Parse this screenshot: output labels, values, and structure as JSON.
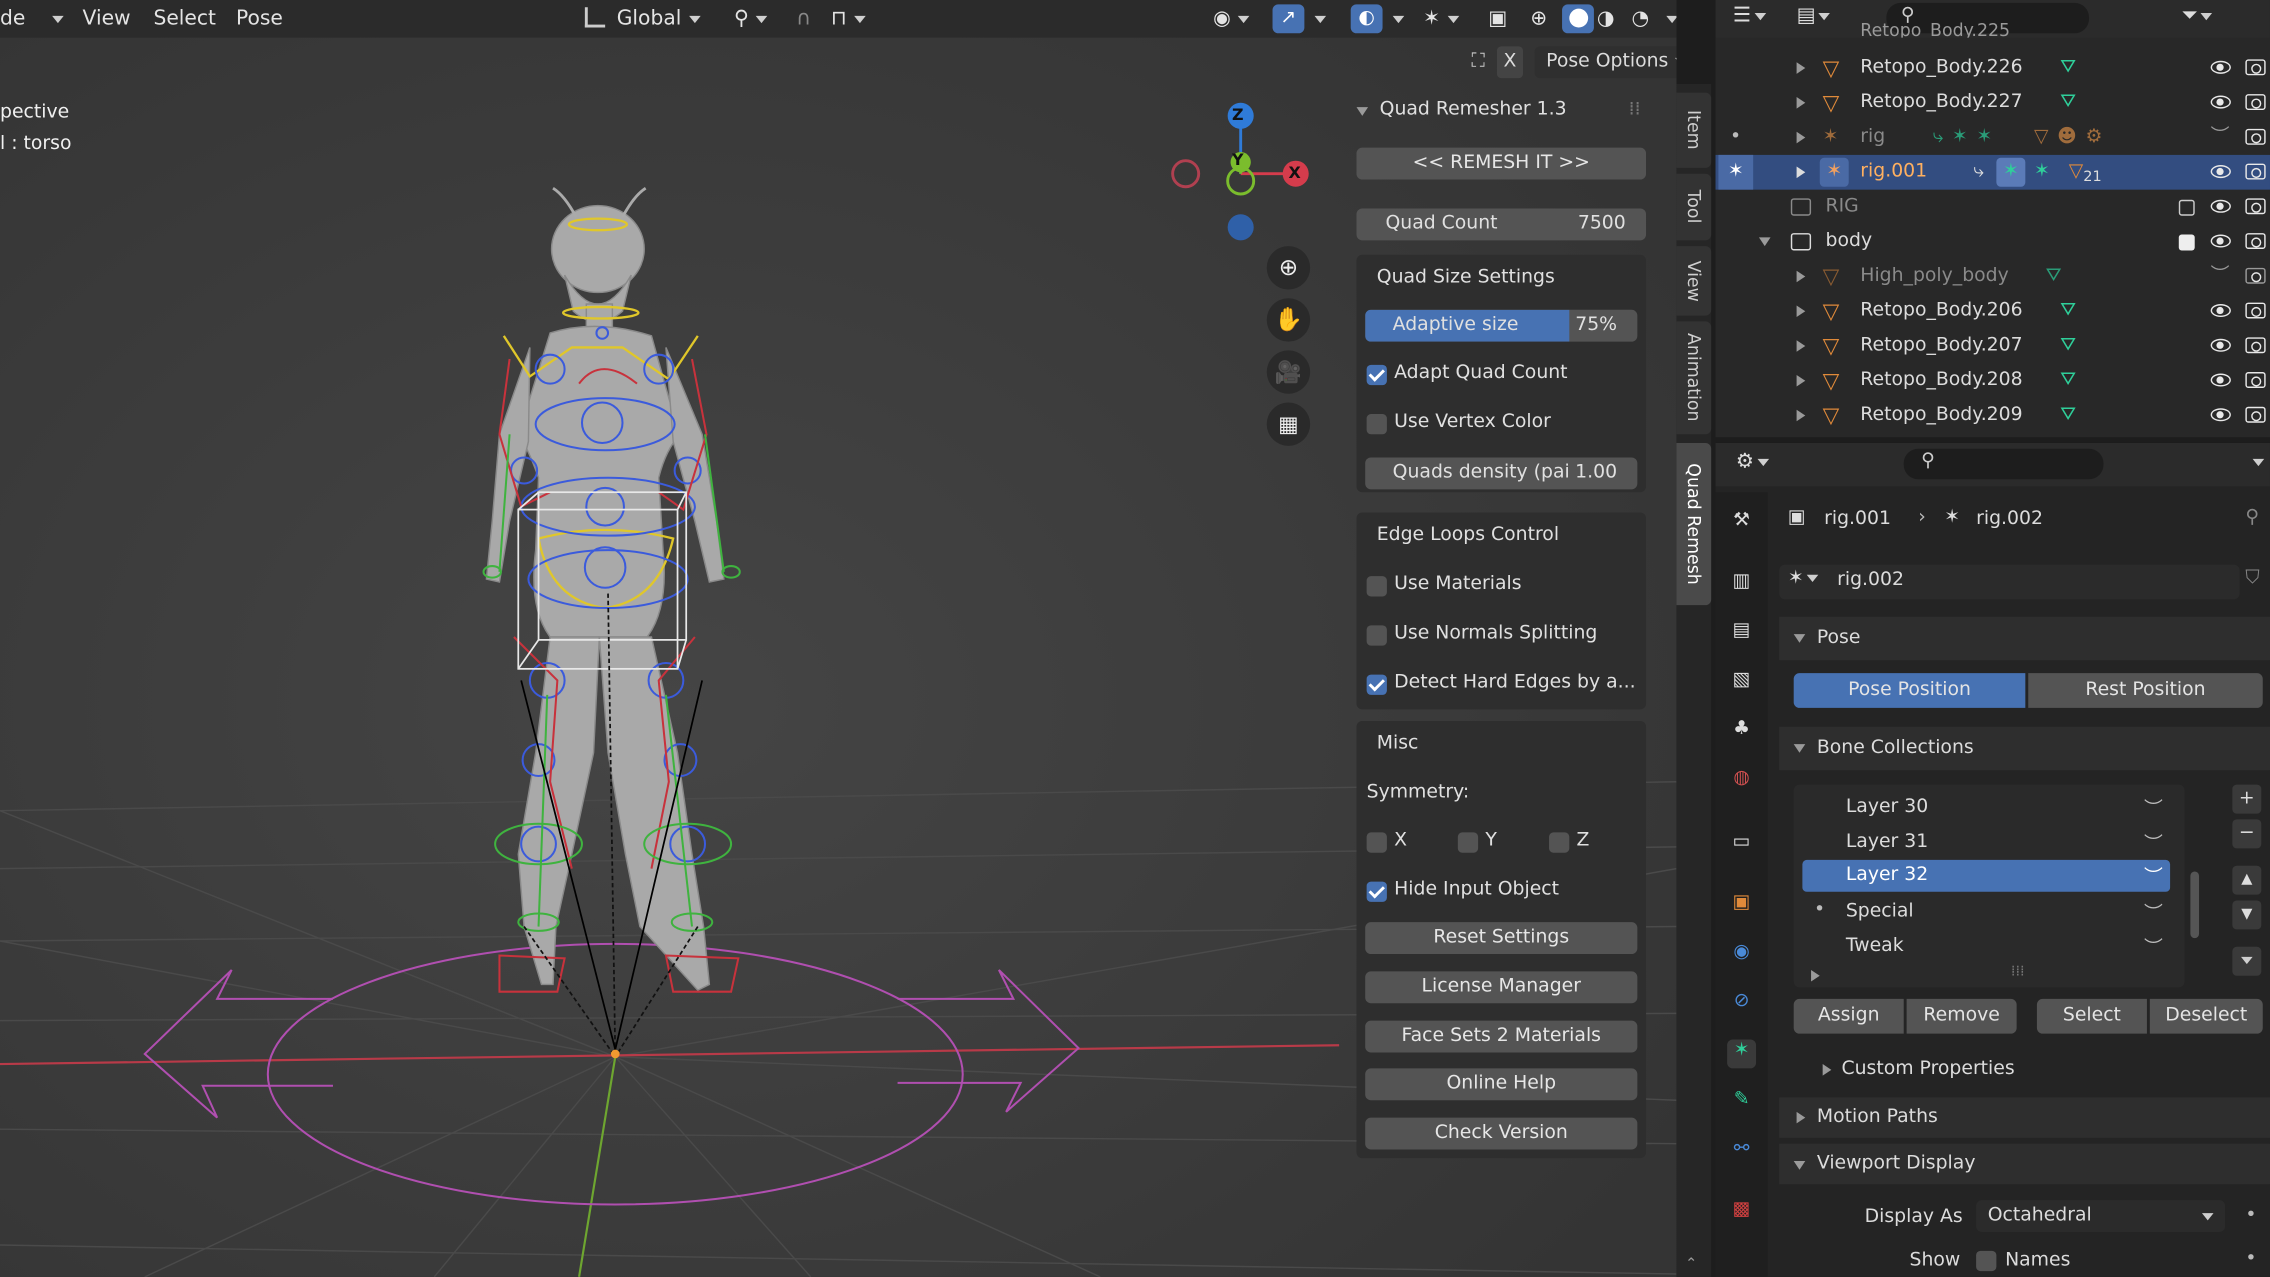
{
  "viewport_header": {
    "mode_fragment": "de",
    "menu": [
      "View",
      "Select",
      "Pose"
    ],
    "orientation": "Global",
    "pose_options": "Pose Options",
    "x_label": "X"
  },
  "viewport": {
    "overlay_line1": "pective",
    "overlay_line2": "l : torso",
    "gizmo": {
      "z": "Z",
      "y": "Y",
      "x": "X"
    }
  },
  "quad_remesher": {
    "title": "Quad Remesher 1.3",
    "remesh_button": "<< REMESH IT >>",
    "quad_count_label": "Quad Count",
    "quad_count_value": "7500",
    "quad_size_section": "Quad Size Settings",
    "adaptive_size_label": "Adaptive size",
    "adaptive_size_value": "75%",
    "adaptive_size_fraction": 0.75,
    "adapt_quad_count": "Adapt Quad Count",
    "use_vertex_color": "Use Vertex Color",
    "quads_density_label": "Quads density (pai",
    "quads_density_value": "1.00",
    "edge_loops_section": "Edge Loops Control",
    "use_materials": "Use Materials",
    "use_normals_splitting": "Use Normals Splitting",
    "detect_hard_edges": "Detect Hard Edges by a...",
    "misc_section": "Misc",
    "symmetry_label": "Symmetry:",
    "sym_x": "X",
    "sym_y": "Y",
    "sym_z": "Z",
    "hide_input_object": "Hide Input Object",
    "buttons": [
      "Reset Settings",
      "License Manager",
      "Face Sets 2 Materials",
      "Online Help",
      "Check Version"
    ]
  },
  "side_tabs": [
    "Item",
    "Tool",
    "View",
    "Animation",
    "Quad Remesh"
  ],
  "outliner": {
    "top_partial": "Retopo_Body.225",
    "rows": [
      {
        "name": "Retopo_Body.226"
      },
      {
        "name": "Retopo_Body.227"
      },
      {
        "name": "rig"
      },
      {
        "name": "rig.001",
        "badge": "21"
      },
      {
        "name": "RIG"
      },
      {
        "name": "body"
      },
      {
        "name": "High_poly_body"
      },
      {
        "name": "Retopo_Body.206"
      },
      {
        "name": "Retopo_Body.207"
      },
      {
        "name": "Retopo_Body.208"
      },
      {
        "name": "Retopo_Body.209"
      }
    ]
  },
  "properties": {
    "breadcrumb_parent": "rig.001",
    "breadcrumb_child": "rig.002",
    "datablock_name": "rig.002",
    "pose_section": "Pose",
    "pose_position": "Pose Position",
    "rest_position": "Rest Position",
    "bone_collections_section": "Bone Collections",
    "collections": [
      "Layer 30",
      "Layer 31",
      "Layer 32",
      "Special",
      "Tweak"
    ],
    "selected_collection": "Layer 32",
    "actions": [
      "Assign",
      "Remove",
      "Select",
      "Deselect"
    ],
    "custom_properties": "Custom Properties",
    "motion_paths": "Motion Paths",
    "viewport_display": "Viewport Display",
    "display_as_label": "Display As",
    "display_as_value": "Octahedral",
    "show_label": "Show",
    "names_label": "Names"
  },
  "colors": {
    "accent": "#4772b3",
    "x_axis": "#d53c4c",
    "y_axis": "#7bbd2d",
    "z_axis": "#2f7bd8",
    "rig_icon": "#e08a3a",
    "mesh_icon": "#2fcf9a"
  }
}
